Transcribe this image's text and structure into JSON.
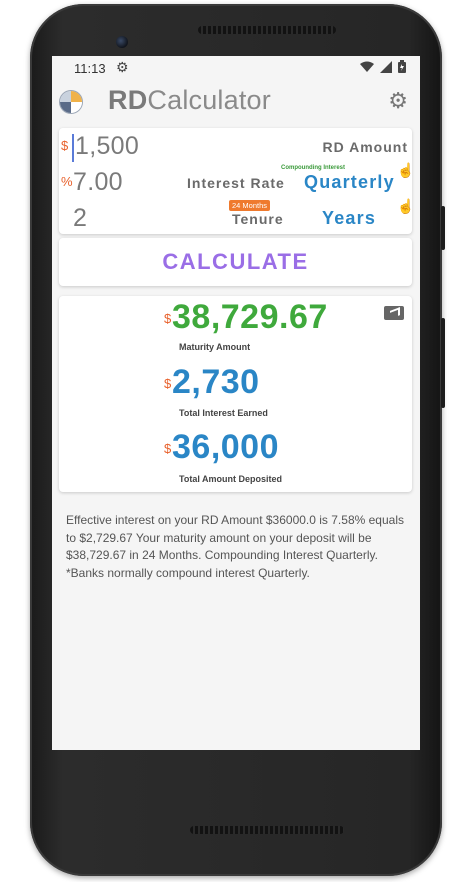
{
  "status": {
    "time": "11:13"
  },
  "app": {
    "title_bold": "RD",
    "title_rest": "Calculator"
  },
  "inputs": {
    "amount": {
      "currency": "$",
      "value": "1,500",
      "label": "RD Amount"
    },
    "rate": {
      "currency": "%",
      "value": "7.00",
      "label": "Interest Rate",
      "compounding_caption": "Compounding Interest",
      "compounding_value": "Quarterly"
    },
    "tenure": {
      "value": "2",
      "badge": "24 Months",
      "label": "Tenure",
      "unit": "Years"
    }
  },
  "calculate": {
    "label": "CALCULATE"
  },
  "results": {
    "maturity": {
      "currency": "$",
      "value": "38,729.67",
      "label": "Maturity Amount",
      "color": "#3fa93c"
    },
    "interest": {
      "currency": "$",
      "value": "2,730",
      "label": "Total Interest Earned",
      "color": "#2a86c6"
    },
    "deposited": {
      "currency": "$",
      "value": "36,000",
      "label": "Total Amount Deposited",
      "color": "#2a86c6"
    }
  },
  "explanation": {
    "line1": "Effective interest on your RD Amount $36000.0 is 7.58% equals",
    "line2": "to $2,729.67 Your maturity amount on your deposit will be",
    "line3": "$38,729.67 in 24 Months. Compounding Interest Quarterly.",
    "line4": "*Banks normally compound interest Quarterly."
  },
  "colors": {
    "accent_orange": "#e8612c",
    "accent_purple": "#9a6ee6",
    "accent_blue": "#2a86c6",
    "accent_green": "#3fa93c"
  }
}
